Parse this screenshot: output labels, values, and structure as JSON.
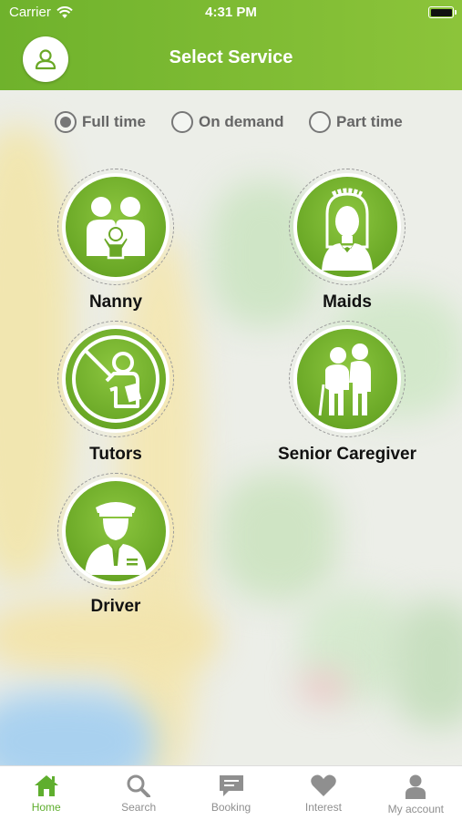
{
  "status_bar": {
    "carrier": "Carrier",
    "time": "4:31 PM"
  },
  "header": {
    "title": "Select Service"
  },
  "employment_options": [
    {
      "label": "Full time",
      "selected": true
    },
    {
      "label": "On demand",
      "selected": false
    },
    {
      "label": "Part time",
      "selected": false
    }
  ],
  "services": [
    {
      "label": "Nanny"
    },
    {
      "label": "Maids"
    },
    {
      "label": "Tutors"
    },
    {
      "label": "Senior Caregiver"
    },
    {
      "label": "Driver"
    }
  ],
  "tabbar": [
    {
      "label": "Home",
      "icon": "home-icon",
      "active": true
    },
    {
      "label": "Search",
      "icon": "search-icon",
      "active": false
    },
    {
      "label": "Booking",
      "icon": "chat-icon",
      "active": false
    },
    {
      "label": "Interest",
      "icon": "heart-icon",
      "active": false
    },
    {
      "label": "My account",
      "icon": "person-icon",
      "active": false
    }
  ],
  "colors": {
    "brand_green": "#6fb22c",
    "active_tab": "#5fae2e"
  }
}
